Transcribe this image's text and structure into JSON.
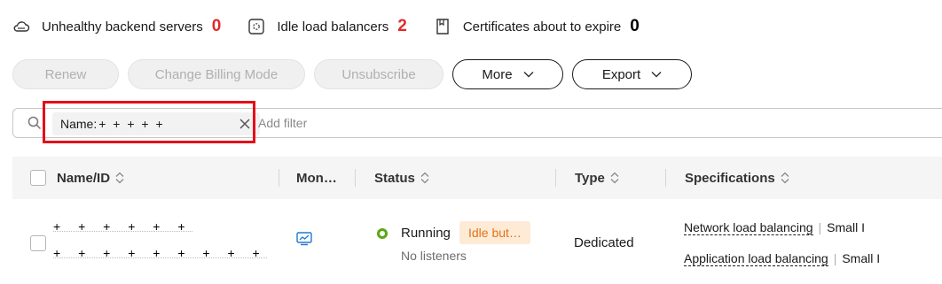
{
  "summary": {
    "unhealthy": {
      "label": "Unhealthy backend servers",
      "value": "0"
    },
    "idle": {
      "label": "Idle load balancers",
      "value": "2"
    },
    "certs": {
      "label": "Certificates about to expire",
      "value": "0"
    }
  },
  "toolbar": {
    "renew": "Renew",
    "change_billing": "Change Billing Mode",
    "unsubscribe": "Unsubscribe",
    "more": "More",
    "export": "Export"
  },
  "search": {
    "chip_key": "Name:",
    "chip_value": "+ + + + +",
    "placeholder": "Add filter"
  },
  "table": {
    "headers": {
      "name": "Name/ID",
      "monitoring": "Mon…",
      "status": "Status",
      "type": "Type",
      "specs": "Specifications"
    },
    "rows": [
      {
        "name_masked": "+ + + + + +",
        "id_masked": "+ + + + + + + + +",
        "status": "Running",
        "badge": "Idle but…",
        "substatus": "No listeners",
        "type": "Dedicated",
        "spec1_link": "Network load balancing",
        "spec1_size": "Small I",
        "spec2_link": "Application load balancing",
        "spec2_size": "Small I"
      }
    ]
  },
  "colors": {
    "red": "#e02b2b",
    "status_green": "#59a716",
    "badge_bg": "#fdebd6",
    "badge_text": "#e37219",
    "highlight": "#e40d18"
  }
}
